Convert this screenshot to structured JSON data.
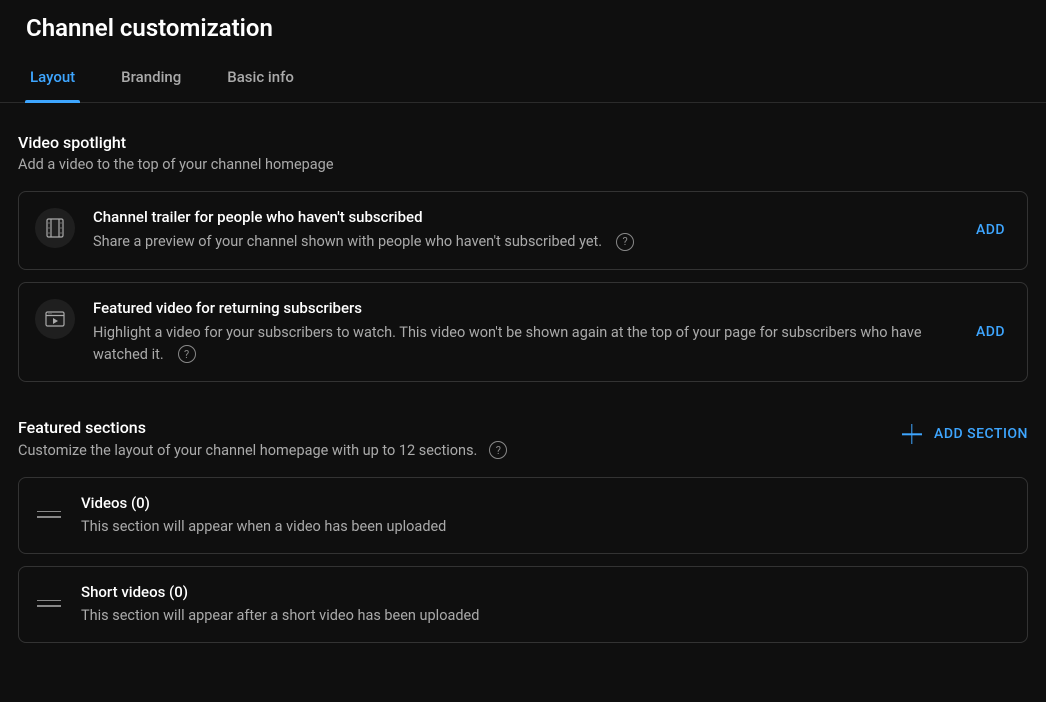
{
  "pageTitle": "Channel customization",
  "tabs": [
    {
      "label": "Layout",
      "active": true
    },
    {
      "label": "Branding",
      "active": false
    },
    {
      "label": "Basic info",
      "active": false
    }
  ],
  "spotlight": {
    "title": "Video spotlight",
    "description": "Add a video to the top of your channel homepage",
    "trailer": {
      "title": "Channel trailer for people who haven't subscribed",
      "description": "Share a preview of your channel shown with people who haven't subscribed yet.",
      "action": "ADD"
    },
    "featured": {
      "title": "Featured video for returning subscribers",
      "description": "Highlight a video for your subscribers to watch. This video won't be shown again at the top of your page for subscribers who have watched it.",
      "action": "ADD"
    }
  },
  "featuredSections": {
    "title": "Featured sections",
    "description": "Customize the layout of your channel homepage with up to 12 sections.",
    "addSection": "ADD SECTION",
    "items": [
      {
        "title": "Videos (0)",
        "description": "This section will appear when a video has been uploaded"
      },
      {
        "title": "Short videos (0)",
        "description": "This section will appear after a short video has been uploaded"
      }
    ]
  },
  "helpGlyph": "?"
}
